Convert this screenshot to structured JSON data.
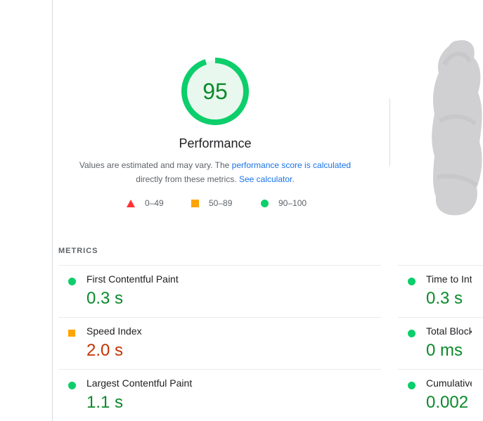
{
  "gauge": {
    "score": "95",
    "score_fraction": 0.95,
    "color": "#0cce6b"
  },
  "performance": {
    "title": "Performance"
  },
  "description": {
    "prefix": "Values are estimated and may vary. The ",
    "link1": "performance score is calculated",
    "middle": " directly from these metrics. ",
    "link2": "See calculator",
    "suffix": "."
  },
  "legend": [
    {
      "icon": "triangle-icon",
      "label": "0–49",
      "color": "#ff3333"
    },
    {
      "icon": "square-icon",
      "label": "50–89",
      "color": "#ffa400"
    },
    {
      "icon": "circle-icon",
      "label": "90–100",
      "color": "#0cce6b"
    }
  ],
  "metrics": {
    "header": "METRICS",
    "left": [
      {
        "label": "First Contentful Paint",
        "value": "0.3 s",
        "status": "good"
      },
      {
        "label": "Speed Index",
        "value": "2.0 s",
        "status": "average"
      },
      {
        "label": "Largest Contentful Paint",
        "value": "1.1 s",
        "status": "good"
      }
    ],
    "right": [
      {
        "label": "Time to Interactive",
        "value": "0.3 s",
        "status": "good"
      },
      {
        "label": "Total Blocking Time",
        "value": "0 ms",
        "status": "good"
      },
      {
        "label": "Cumulative Layout Shift",
        "value": "0.002",
        "status": "good"
      }
    ]
  }
}
